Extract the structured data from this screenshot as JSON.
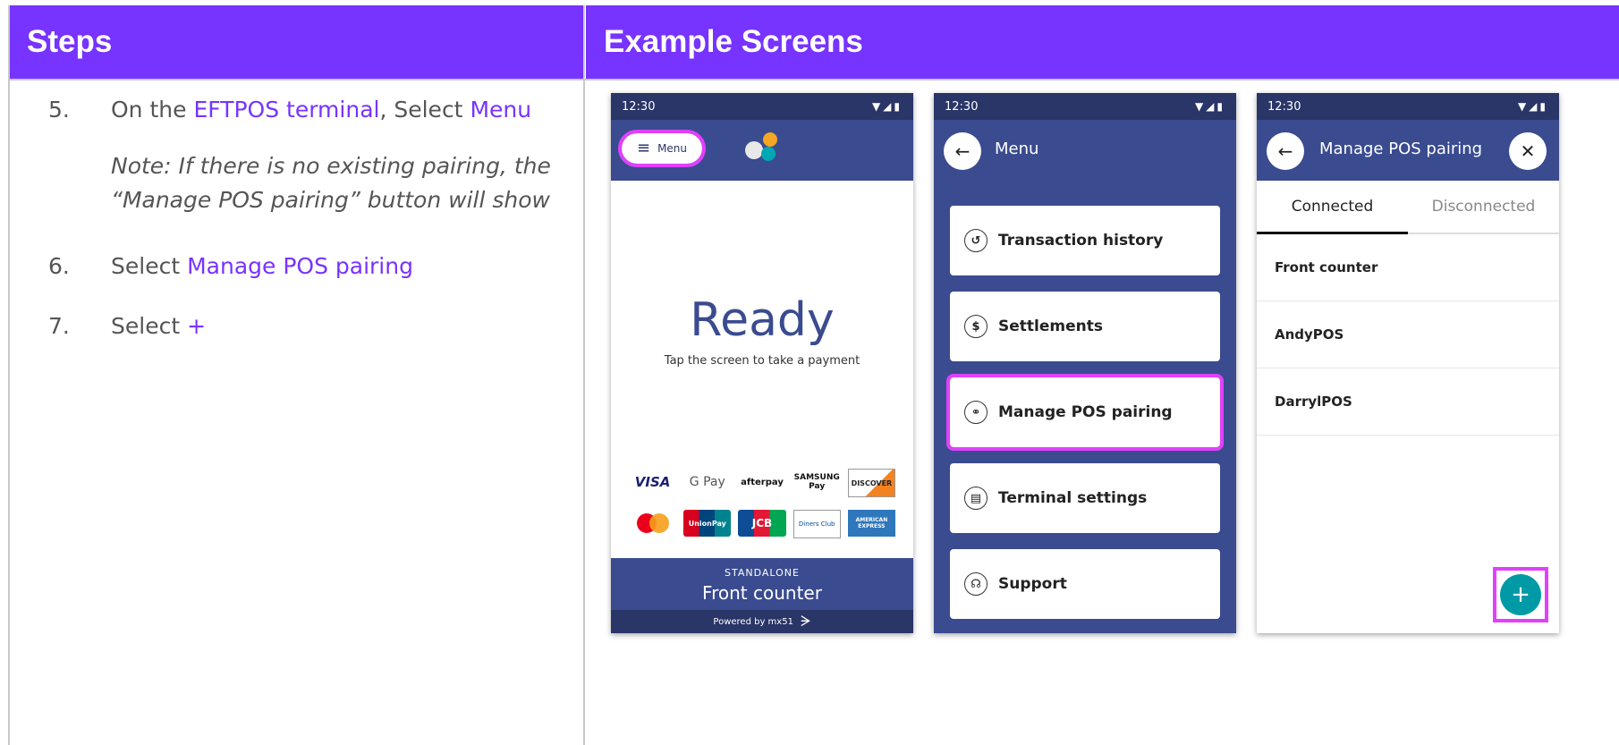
{
  "headers": {
    "steps": "Steps",
    "examples": "Example Screens"
  },
  "steps": [
    {
      "num": "5.",
      "pre": "On the ",
      "link1": "EFTPOS terminal",
      "mid": ", Select ",
      "link2": "Menu"
    },
    {
      "note": "Note: If there is no existing pairing, the “Manage POS pairing” button will show"
    },
    {
      "num": "6.",
      "pre": "Select ",
      "link1": "Manage POS pairing"
    },
    {
      "num": "7.",
      "pre": "Select ",
      "link1": "+"
    }
  ],
  "phone1": {
    "time": "12:30",
    "menu_label": "Menu",
    "ready": "Ready",
    "tap": "Tap the screen to take a payment",
    "cards": [
      "VISA",
      "G Pay",
      "afterpay",
      "SAMSUNG Pay",
      "DISCOVER",
      "mastercard",
      "UnionPay",
      "JCB",
      "Diners Club",
      "AMERICAN EXPRESS"
    ],
    "mode": "STANDALONE",
    "terminal_name": "Front counter",
    "powered": "Powered by mx51"
  },
  "phone2": {
    "time": "12:30",
    "title": "Menu",
    "items": [
      "Transaction history",
      "Settlements",
      "Manage POS pairing",
      "Terminal settings",
      "Support"
    ]
  },
  "phone3": {
    "time": "12:30",
    "title": "Manage POS pairing",
    "tabs": [
      "Connected",
      "Disconnected"
    ],
    "rows": [
      "Front counter",
      "AndyPOS",
      "DarrylPOS"
    ],
    "fab": "+"
  },
  "colors": {
    "accent": "#7733ff",
    "navy": "#3a4b8f",
    "highlight": "#e040fb",
    "teal": "#009aa6"
  }
}
